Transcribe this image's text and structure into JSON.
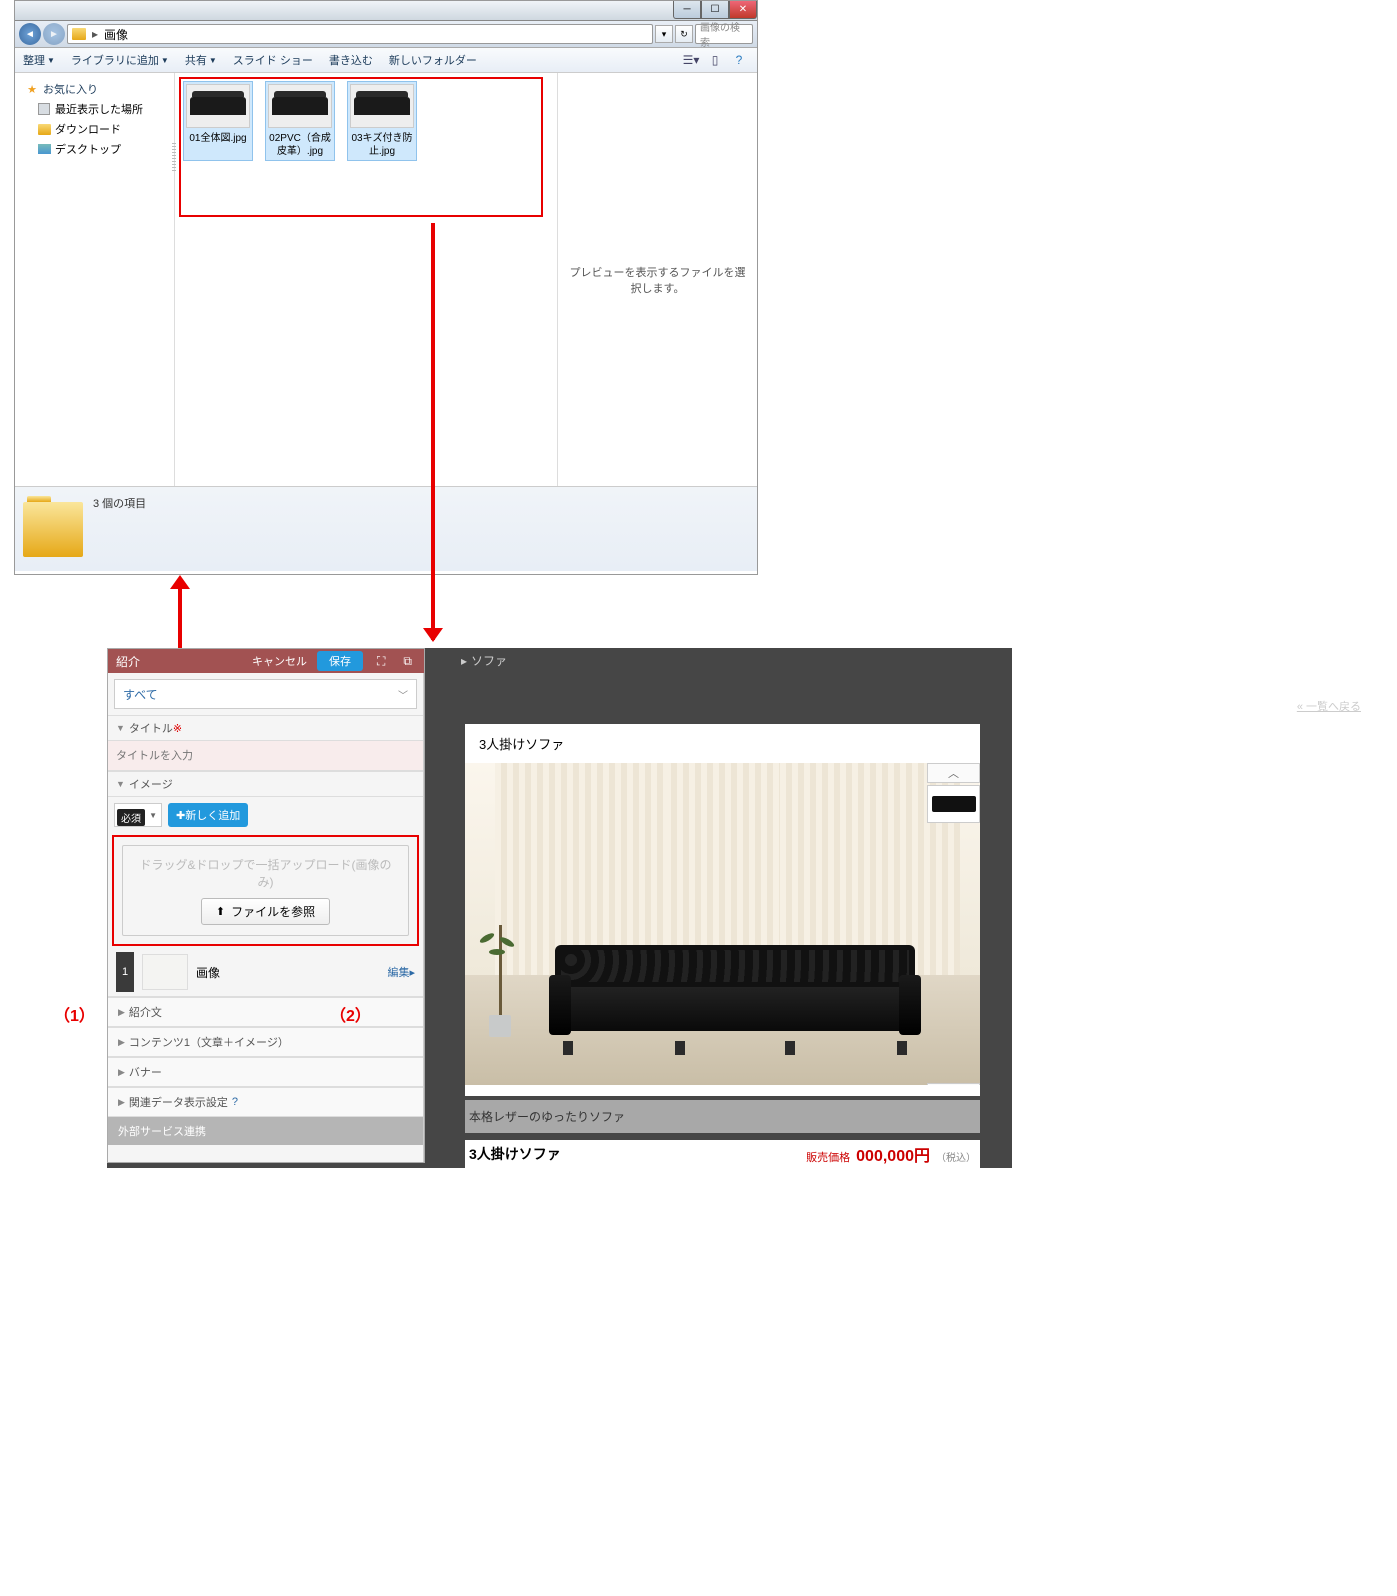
{
  "explorer": {
    "breadcrumb": "画像",
    "search_placeholder": "画像の検索",
    "toolbar": {
      "organize": "整理",
      "add_library": "ライブラリに追加",
      "share": "共有",
      "slideshow": "スライド ショー",
      "burn": "書き込む",
      "new_folder": "新しいフォルダー"
    },
    "sidebar": {
      "fav": "お気に入り",
      "recent": "最近表示した場所",
      "downloads": "ダウンロード",
      "desktop": "デスクトップ"
    },
    "files": [
      {
        "name": "01全体図.jpg"
      },
      {
        "name": "02PVC（合成皮革）.jpg"
      },
      {
        "name": "03キズ付き防止.jpg"
      }
    ],
    "preview_msg": "プレビューを表示するファイルを選択します。",
    "status": "3 個の項目"
  },
  "editpanel": {
    "header": "紹介",
    "cancel": "キャンセル",
    "save": "保存",
    "filter": "すべて",
    "title_section": "タイトル",
    "title_placeholder": "タイトルを入力",
    "req_badge": "必須",
    "image_section": "イメージ",
    "dropdown_media": "画像",
    "add_new": "新しく追加",
    "drop_text": "ドラッグ&ドロップで一括アップロード(画像のみ)",
    "browse": "ファイルを参照",
    "item_num": "1",
    "item_label": "画像",
    "edit": "編集",
    "intro": "紹介文",
    "contents1": "コンテンツ1（文章＋イメージ）",
    "banner": "バナー",
    "related": "関連データ表示設定",
    "external": "外部サービス連携"
  },
  "annotations": {
    "a1": "（1）",
    "a2": "（2）"
  },
  "product": {
    "breadcrumb": "ソファ",
    "back": "« 一覧へ戻る",
    "title": "3人掛けソファ",
    "desc": "本格レザーのゆったりソファ",
    "name": "3人掛けソファ",
    "price_label": "販売価格",
    "price_value": "000,000円",
    "tax": "（税込）"
  }
}
